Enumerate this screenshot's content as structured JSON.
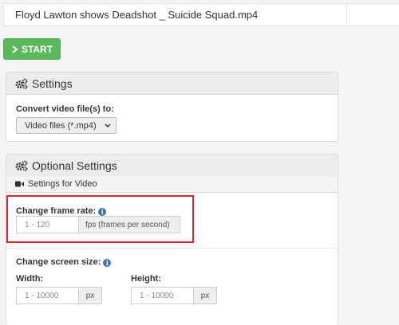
{
  "file": {
    "name": "Floyd Lawton shows Deadshot _ Suicide Squad.mp4"
  },
  "start_button": {
    "label": "START"
  },
  "settings": {
    "title": "Settings",
    "convert_label": "Convert video file(s) to:",
    "format_selected": "Video files (*.mp4)"
  },
  "optional": {
    "title": "Optional Settings",
    "video_subtitle": "Settings for Video",
    "frame_rate": {
      "label": "Change frame rate:",
      "placeholder": "1 - 120",
      "unit": "fps (frames per second)"
    },
    "screen_size": {
      "label": "Change screen size:",
      "width_label": "Width:",
      "height_label": "Height:",
      "width_placeholder": "1 - 10000",
      "height_placeholder": "1 - 10000",
      "unit": "px"
    }
  },
  "colors": {
    "start_green": "#5cb85c",
    "highlight_red": "#d9252a",
    "info_blue": "#3b73b9"
  }
}
